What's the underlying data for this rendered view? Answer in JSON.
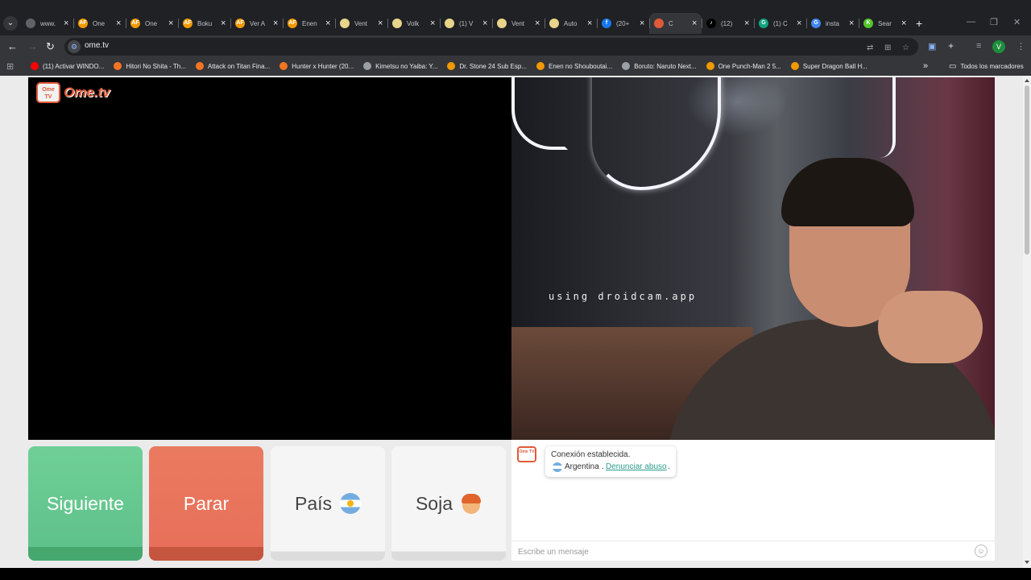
{
  "browser": {
    "tabs": [
      {
        "title": "www.",
        "icon": "globe-icon",
        "color": "#5f6368",
        "glyph": ""
      },
      {
        "title": "One",
        "icon": "af-icon",
        "color": "#f29900",
        "glyph": "AF"
      },
      {
        "title": "One",
        "icon": "af-icon",
        "color": "#f29900",
        "glyph": "AF"
      },
      {
        "title": "Boku",
        "icon": "af-icon",
        "color": "#f29900",
        "glyph": "AF"
      },
      {
        "title": "Ver A",
        "icon": "af-icon",
        "color": "#f29900",
        "glyph": "AF"
      },
      {
        "title": "Enen",
        "icon": "af-icon",
        "color": "#f29900",
        "glyph": "AF"
      },
      {
        "title": "Vent",
        "icon": "yellow-dot-icon",
        "color": "#e8d48a",
        "glyph": ""
      },
      {
        "title": "Volk",
        "icon": "yellow-dot-icon",
        "color": "#e8d48a",
        "glyph": ""
      },
      {
        "title": "(1) V",
        "icon": "yellow-dot-icon",
        "color": "#e8d48a",
        "glyph": ""
      },
      {
        "title": "Vent",
        "icon": "yellow-dot-icon",
        "color": "#e8d48a",
        "glyph": ""
      },
      {
        "title": "Auto",
        "icon": "yellow-dot-icon",
        "color": "#e8d48a",
        "glyph": ""
      },
      {
        "title": "(20+",
        "icon": "facebook-icon",
        "color": "#1877f2",
        "glyph": "f"
      },
      {
        "title": "C",
        "icon": "ometv-icon",
        "color": "#e05a3a",
        "glyph": "",
        "active": true
      },
      {
        "title": "(12)",
        "icon": "tiktok-icon",
        "color": "#000000",
        "glyph": "♪"
      },
      {
        "title": "(1) C",
        "icon": "chatgpt-icon",
        "color": "#10a37f",
        "glyph": "G"
      },
      {
        "title": "insta",
        "icon": "google-icon",
        "color": "#4285f4",
        "glyph": "G"
      },
      {
        "title": "Sear",
        "icon": "k-icon",
        "color": "#53c42b",
        "glyph": "K"
      }
    ],
    "address": "ome.tv",
    "profile_initial": "V",
    "bookmarks": [
      {
        "label": "(11) Activar WINDO...",
        "icon": "youtube-icon",
        "color": "#ff0000"
      },
      {
        "label": "Hitori No Shita - Th...",
        "icon": "crunchyroll-icon",
        "color": "#f47521"
      },
      {
        "label": "Attack on Titan Fina...",
        "icon": "crunchyroll-icon",
        "color": "#f47521"
      },
      {
        "label": "Hunter x Hunter (20...",
        "icon": "crunchyroll-icon",
        "color": "#f47521"
      },
      {
        "label": "Kimetsu no Yaiba: Y...",
        "icon": "shield-icon",
        "color": "#9aa0a6"
      },
      {
        "label": "Dr. Stone 24 Sub Esp...",
        "icon": "tp-icon",
        "color": "#f29900"
      },
      {
        "label": "Enen no Shouboutai...",
        "icon": "af-icon",
        "color": "#f29900"
      },
      {
        "label": "Boruto: Naruto Next...",
        "icon": "globe-icon",
        "color": "#9aa0a6"
      },
      {
        "label": "One Punch-Man 2 5...",
        "icon": "tp-icon",
        "color": "#f29900"
      },
      {
        "label": "Super Dragon Ball H...",
        "icon": "tp-icon",
        "color": "#f29900"
      }
    ],
    "bookmarks_folder": "Todos los marcadores"
  },
  "site": {
    "logo_text": "Ome.tv",
    "logo_badge": "Ome TV",
    "watermark": "using droidcam.app"
  },
  "buttons": {
    "next": "Siguiente",
    "stop": "Parar",
    "country": "País",
    "gender": "Soja"
  },
  "chat": {
    "status": "Conexión establecida.",
    "country": "Argentina",
    "separator": ".",
    "report_link": "Denunciar abuso",
    "end_dot": ".",
    "input_placeholder": "Escribe un mensaje"
  }
}
